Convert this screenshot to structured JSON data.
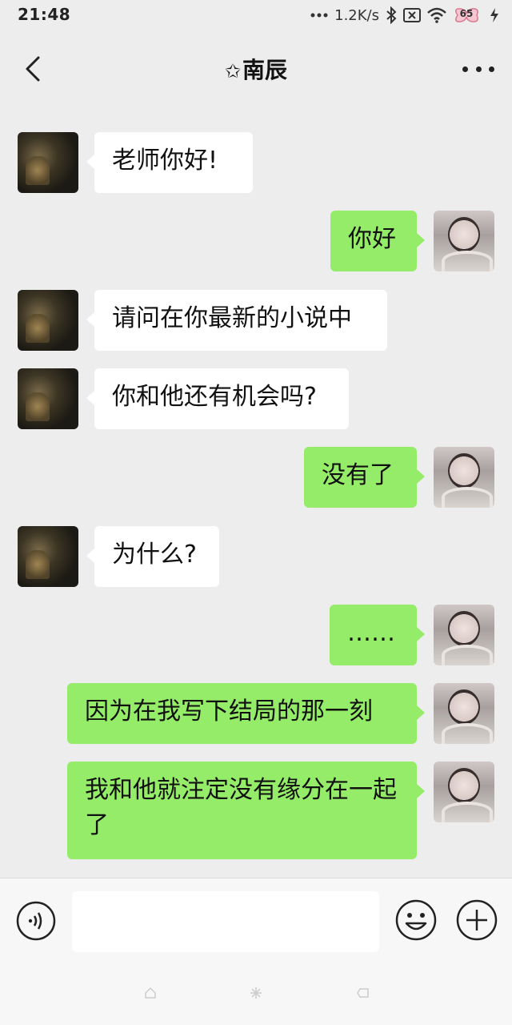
{
  "status_bar": {
    "time": "21:48",
    "network_speed": "1.2K/s",
    "battery_level": "65",
    "icons": [
      "dots-icon",
      "bluetooth-icon",
      "sim-off-icon",
      "wifi-icon",
      "battery-icon",
      "charging-icon"
    ]
  },
  "header": {
    "title_prefix": "✩",
    "title": "南辰",
    "icons": [
      "back-icon",
      "more-icon"
    ]
  },
  "messages": [
    {
      "side": "left",
      "text": "老师你好!"
    },
    {
      "side": "right",
      "text": "你好"
    },
    {
      "side": "left",
      "text": "请问在你最新的小说中"
    },
    {
      "side": "left",
      "text": "你和他还有机会吗?"
    },
    {
      "side": "right",
      "text": "没有了"
    },
    {
      "side": "left",
      "text": "为什么?"
    },
    {
      "side": "right",
      "text": "……"
    },
    {
      "side": "right",
      "text": "因为在我写下结局的那一刻"
    },
    {
      "side": "right",
      "text": "我和他就注定没有缘分在一起了"
    }
  ],
  "input_bar": {
    "placeholder": "",
    "icons": [
      "voice-icon",
      "emoji-icon",
      "plus-icon"
    ]
  },
  "colors": {
    "background": "#ededed",
    "bubble_self": "#95ec69",
    "bubble_other": "#ffffff"
  }
}
